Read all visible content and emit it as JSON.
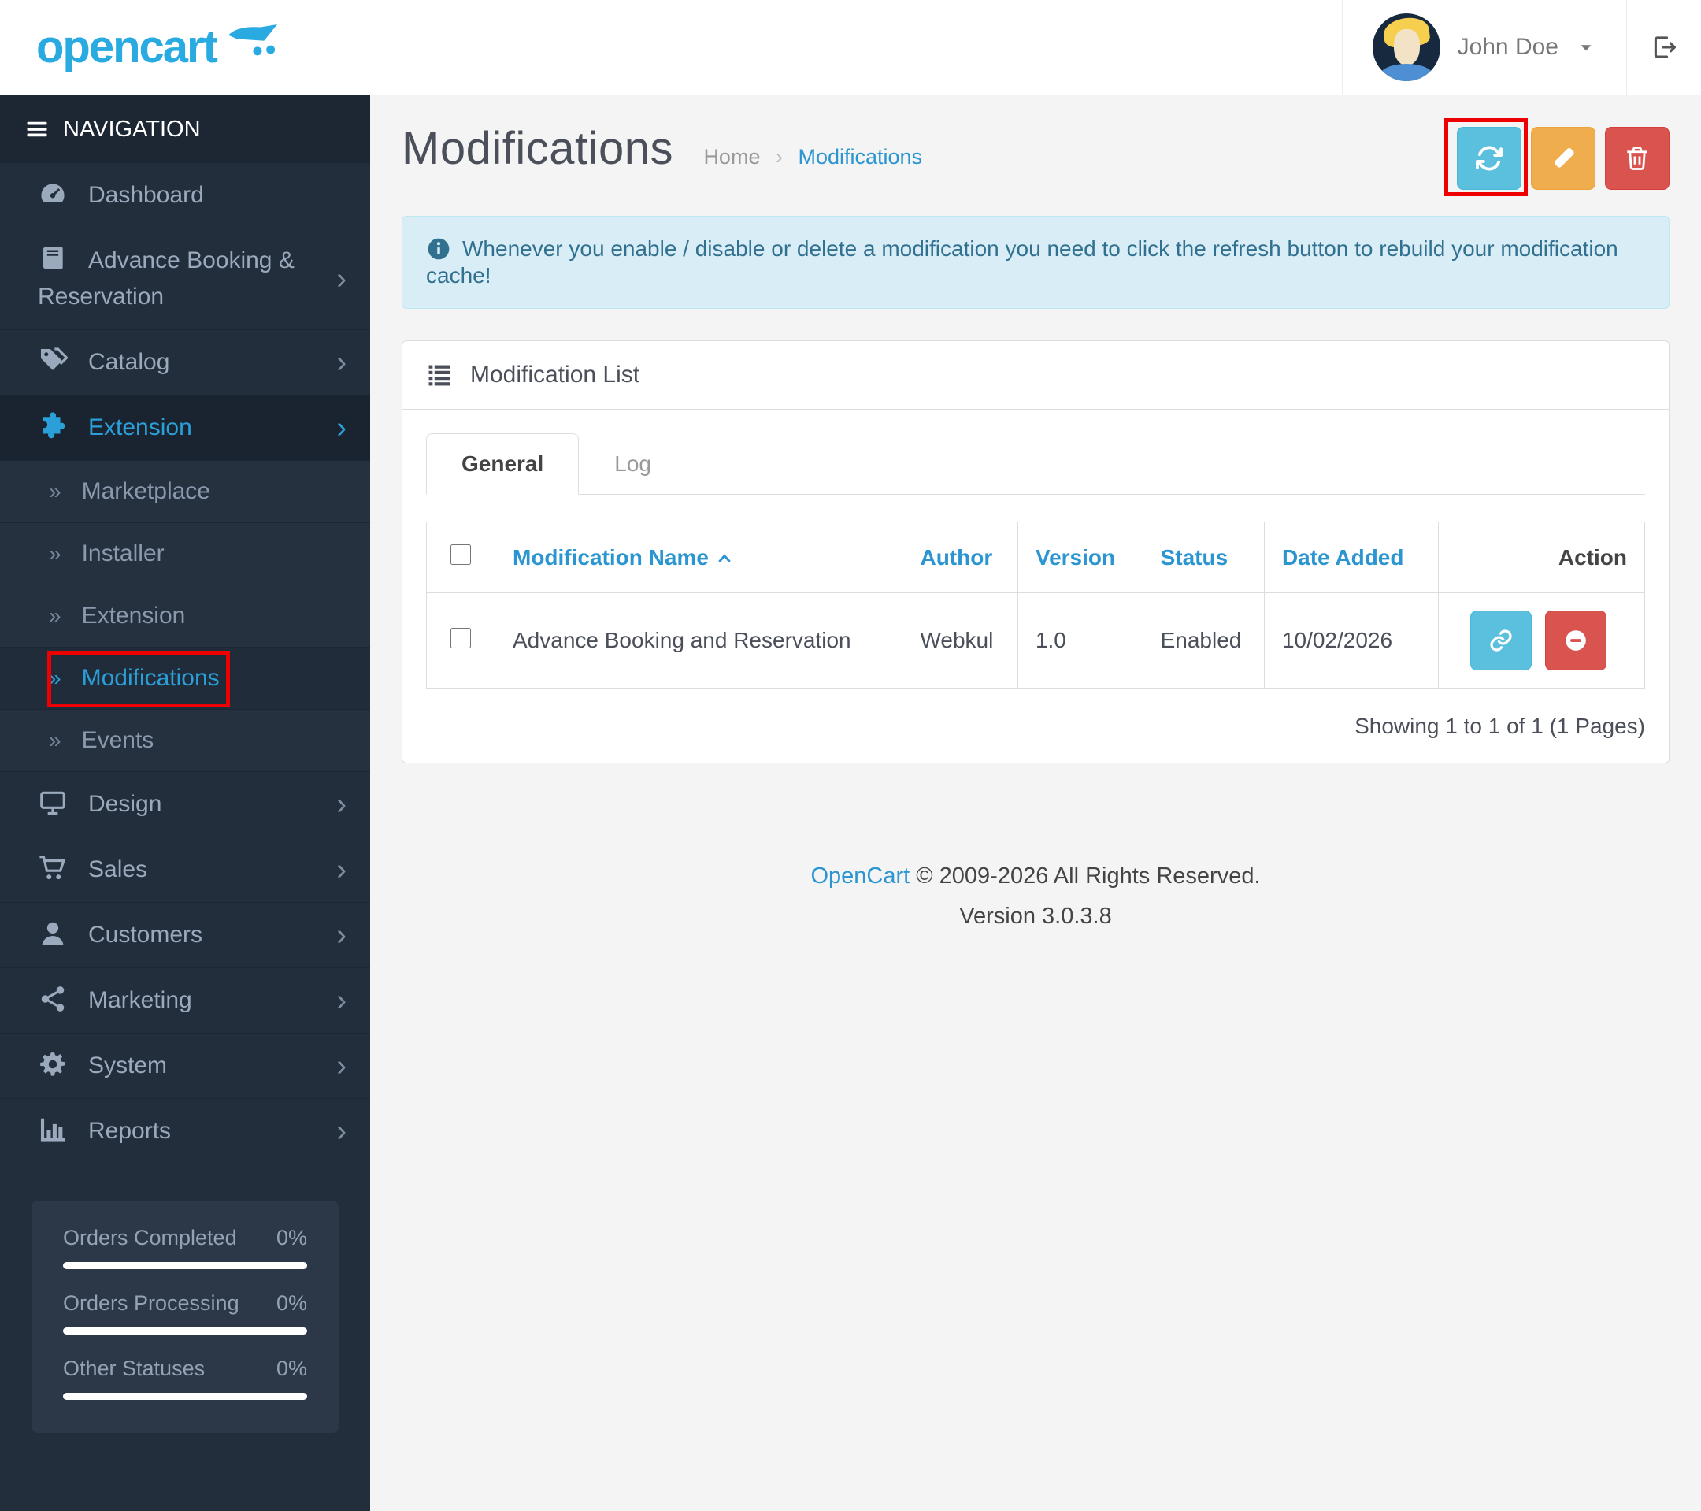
{
  "header": {
    "logo_text": "opencart",
    "user_name": "John Doe"
  },
  "sidebar": {
    "nav_header": "NAVIGATION",
    "items": [
      {
        "label": "Dashboard"
      },
      {
        "label": "Advance Booking & Reservation"
      },
      {
        "label": "Catalog"
      },
      {
        "label": "Extension"
      },
      {
        "label": "Marketplace"
      },
      {
        "label": "Installer"
      },
      {
        "label": "Extension"
      },
      {
        "label": "Modifications"
      },
      {
        "label": "Events"
      },
      {
        "label": "Design"
      },
      {
        "label": "Sales"
      },
      {
        "label": "Customers"
      },
      {
        "label": "Marketing"
      },
      {
        "label": "System"
      },
      {
        "label": "Reports"
      }
    ],
    "stats": [
      {
        "label": "Orders Completed",
        "value": "0%"
      },
      {
        "label": "Orders Processing",
        "value": "0%"
      },
      {
        "label": "Other Statuses",
        "value": "0%"
      }
    ]
  },
  "page": {
    "title": "Modifications",
    "breadcrumb": {
      "home": "Home",
      "current": "Modifications"
    },
    "alert_text": "Whenever you enable / disable or delete a modification you need to click the refresh button to rebuild your modification cache!",
    "panel": {
      "title": "Modification List",
      "tabs": [
        {
          "label": "General"
        },
        {
          "label": "Log"
        }
      ],
      "table": {
        "columns": [
          "Modification Name",
          "Author",
          "Version",
          "Status",
          "Date Added",
          "Action"
        ],
        "rows": [
          {
            "name": "Advance Booking and Reservation",
            "author": "Webkul",
            "version": "1.0",
            "status": "Enabled",
            "date_added": "10/02/2026"
          }
        ]
      },
      "pagination": "Showing 1 to 1 of 1 (1 Pages)"
    },
    "footer": {
      "copyright_link": "OpenCart",
      "copyright_text": " © 2009-2026 All Rights Reserved.",
      "version": "Version 3.0.3.8"
    }
  },
  "colors": {
    "accent_blue": "#2a95d0",
    "sidebar_active_blue": "#2a9fd8",
    "refresh_button": "#5bc0de",
    "clear_button": "#f0ad4e",
    "delete_button": "#d9534f",
    "alert_text": "#31708f",
    "annotation_red": "#ee0000",
    "sidebar_bg": "#232e3d",
    "logo_blue": "#29abe2"
  }
}
